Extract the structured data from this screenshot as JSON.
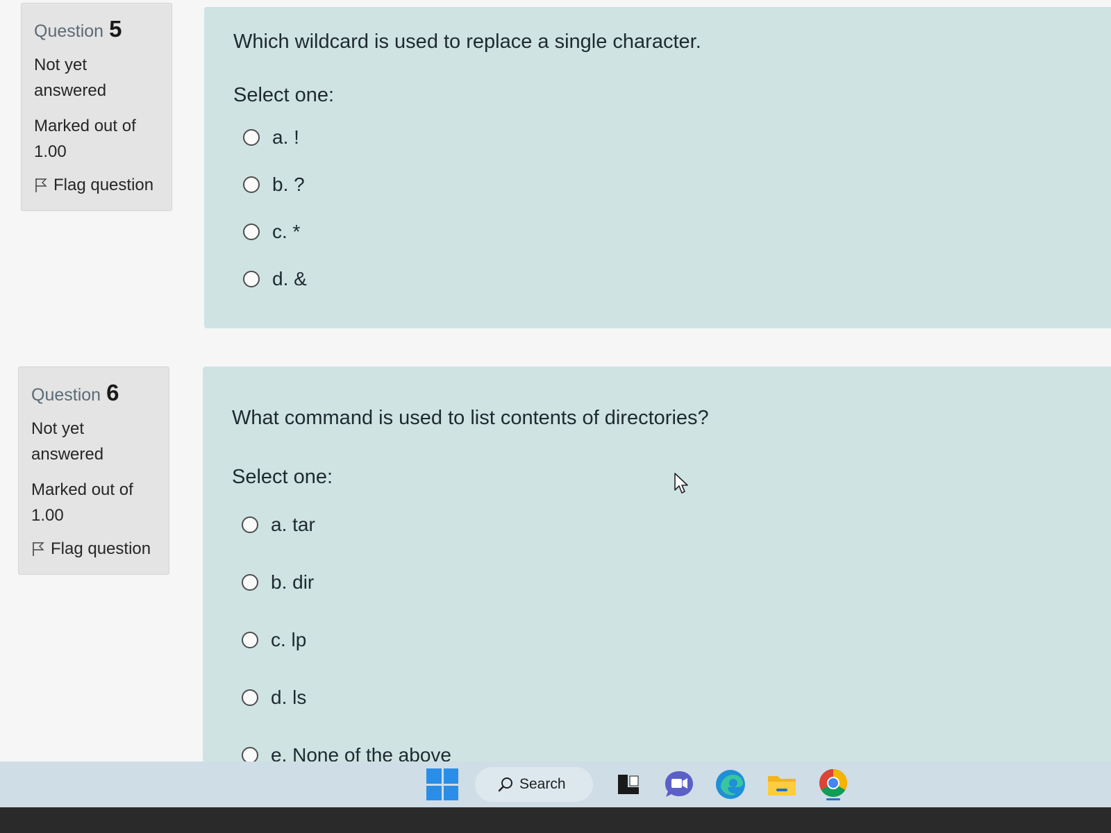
{
  "questions": [
    {
      "label": "Question",
      "number": "5",
      "state": "Not yet answered",
      "grade": "Marked out of 1.00",
      "flag_label": "Flag question",
      "text": "Which wildcard is used to replace a single character.",
      "prompt": "Select one:",
      "options": [
        "a. !",
        "b. ?",
        "c. *",
        "d. &"
      ]
    },
    {
      "label": "Question",
      "number": "6",
      "state": "Not yet answered",
      "grade": "Marked out of 1.00",
      "flag_label": "Flag question",
      "text": "What command is used to list contents of directories?",
      "prompt": "Select one:",
      "options": [
        "a. tar",
        "b. dir",
        "c. lp",
        "d. ls",
        "e. None of the above"
      ]
    }
  ],
  "taskbar": {
    "search_label": "Search",
    "icons": [
      "windows-start-icon",
      "search-icon",
      "task-view-icon",
      "teams-chat-icon",
      "edge-icon",
      "file-explorer-icon",
      "chrome-icon"
    ]
  },
  "colors": {
    "info_bg": "#e4e4e4",
    "content_bg": "#cfe3e3",
    "page_bg": "#f6f6f6",
    "taskbar_bg": "#cfdde6",
    "windows_blue": "#2a8ee8"
  }
}
